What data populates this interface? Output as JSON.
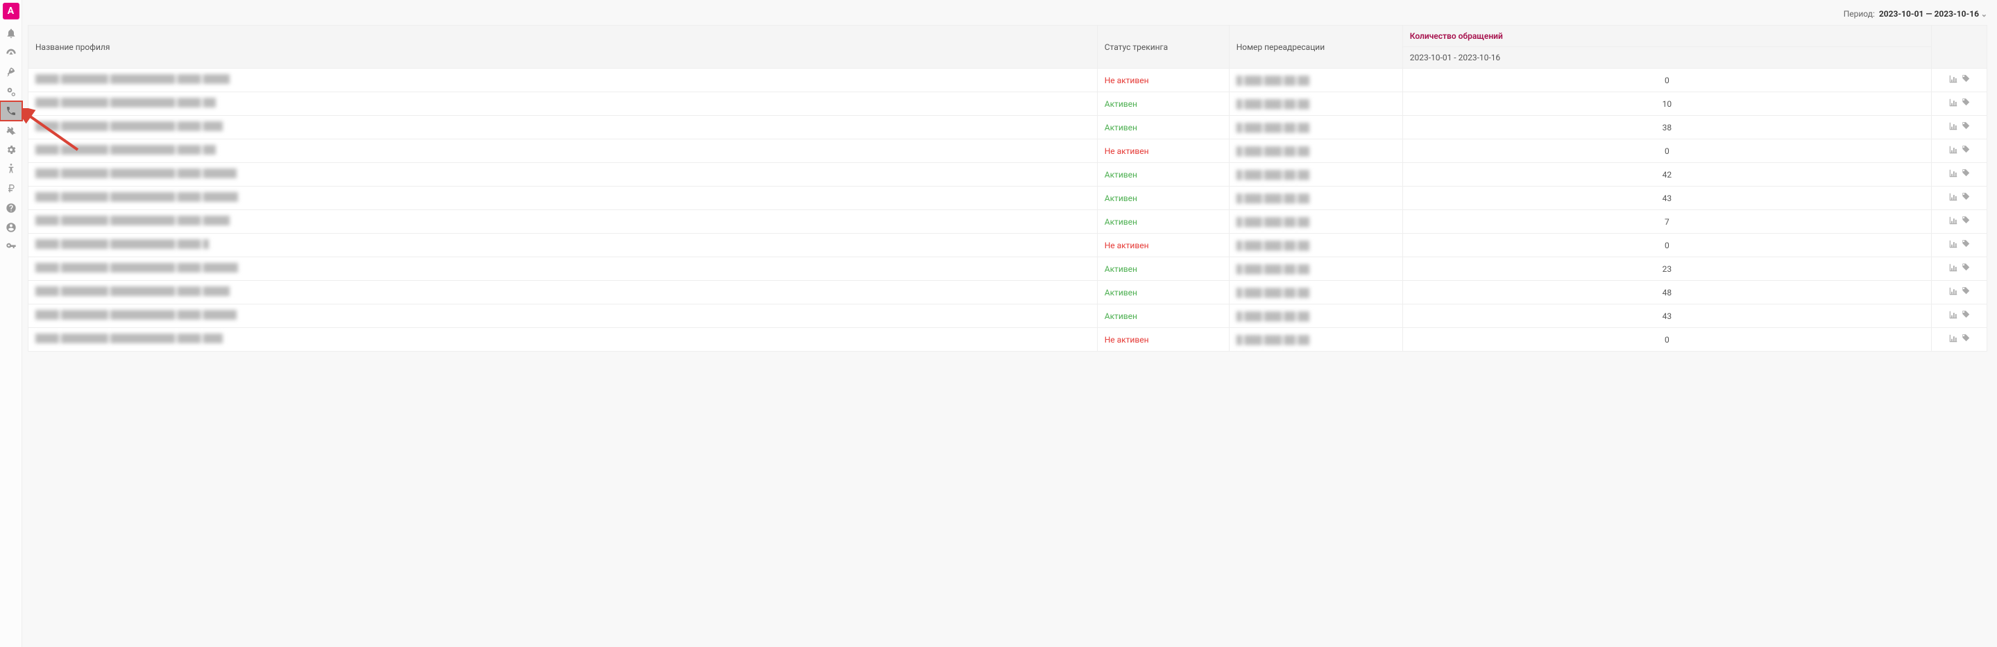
{
  "header": {
    "period_label": "Период:",
    "period_value": "2023-10-01 — 2023-10-16"
  },
  "table": {
    "col_profile": "Название профиля",
    "col_status": "Статус трекинга",
    "col_redirect": "Номер переадресации",
    "col_count": "Количество обращений",
    "col_count_sub": "2023-10-01 - 2023-10-16"
  },
  "status_labels": {
    "active": "Активен",
    "inactive": "Не активен"
  },
  "rows": [
    {
      "active": false,
      "count": 0
    },
    {
      "active": true,
      "count": 10
    },
    {
      "active": true,
      "count": 38
    },
    {
      "active": false,
      "count": 0
    },
    {
      "active": true,
      "count": 42
    },
    {
      "active": true,
      "count": 43
    },
    {
      "active": true,
      "count": 7
    },
    {
      "active": false,
      "count": 0
    },
    {
      "active": true,
      "count": 23
    },
    {
      "active": true,
      "count": 48
    },
    {
      "active": true,
      "count": 43
    },
    {
      "active": false,
      "count": 0
    }
  ],
  "sidebar": {
    "logo_letter": "A"
  }
}
